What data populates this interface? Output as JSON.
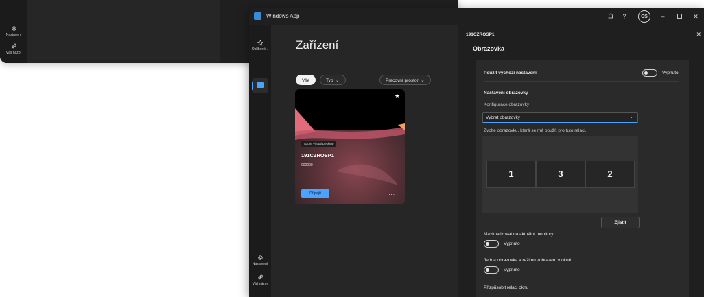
{
  "background_window": {
    "rail_items": [
      {
        "icon": "gear-icon",
        "label": "Nastavení"
      },
      {
        "icon": "people-icon",
        "label": "Váš názor"
      }
    ]
  },
  "window": {
    "title": "Windows App",
    "avatar_initials": "CS",
    "rail": {
      "top_item": {
        "icon": "star-outline-icon",
        "label": "Oblíbené..."
      },
      "bottom_items": [
        {
          "icon": "gear-icon",
          "label": "Nastavení"
        },
        {
          "icon": "people-icon",
          "label": "Váš názor"
        }
      ]
    },
    "devices": {
      "title": "Zařízení",
      "filters": [
        {
          "label": "Vše",
          "active": true
        },
        {
          "label": "Typ",
          "chevron": true
        },
        {
          "label": "Pracovní prostor",
          "chevron": true
        }
      ],
      "card": {
        "tag": "Azure Virtual Desktop",
        "name": "191CZROSP1",
        "subtitle": "000000",
        "connect_label": "Připojit",
        "more_label": "..."
      }
    },
    "settings_panel": {
      "device_name": "191CZROSP1",
      "section_title": "Obrazovka",
      "use_default": {
        "label": "Použít výchozí nastavení",
        "state": "Vypnuto"
      },
      "display_settings_heading": "Nastavení obrazovky",
      "display_config_label": "Konfigurace obrazovky",
      "display_config_value": "Vybrat obrazovky",
      "choose_hint": "Zvolte obrazovku, která se má použít pro tuto relaci.",
      "screens": [
        "1",
        "3",
        "2"
      ],
      "detect_label": "Zjistit",
      "maximize": {
        "label": "Maximalizovat na aktuální monitory",
        "state": "Vypnuto"
      },
      "single_window": {
        "label": "Jedna obrazovka v režimu zobrazení v okně",
        "state": "Vypnuto"
      },
      "fit_session": {
        "label": "Přizpůsobit relaci oknu"
      }
    }
  }
}
